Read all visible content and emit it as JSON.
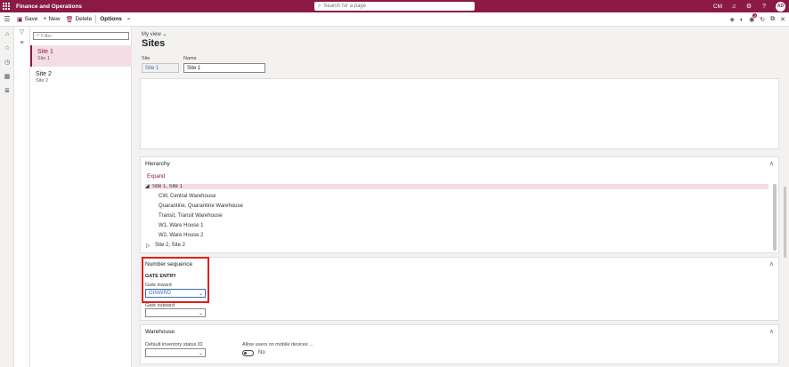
{
  "topbar": {
    "app_title": "Finance and Operations",
    "search_placeholder": "Search for a page",
    "company": "CM",
    "avatar_initials": "AD"
  },
  "actionbar": {
    "save": "Save",
    "new": "New",
    "delete": "Delete",
    "options": "Options",
    "notification_count": "2"
  },
  "list": {
    "filter_placeholder": "Filter",
    "items": [
      {
        "title": "Site 1",
        "subtitle": "Site 1"
      },
      {
        "title": "Site 2",
        "subtitle": "Site 2"
      }
    ]
  },
  "header": {
    "my_view": "My view",
    "page_title": "Sites",
    "site_label": "Site",
    "site_value": "Site 1",
    "name_label": "Name",
    "name_value": "Site 1"
  },
  "hierarchy": {
    "title": "Hierarchy",
    "expand": "Expand",
    "nodes": [
      {
        "label": "Site 1, Site 1",
        "expander": "◢"
      },
      {
        "label": "CW, Central Warehouse"
      },
      {
        "label": "Quarantine, Quarantine Warehouse"
      },
      {
        "label": "Transit, Transit Warehouse"
      },
      {
        "label": "W1, Ware House 1"
      },
      {
        "label": "W2, Ware House 2"
      },
      {
        "label": "Site 2, Site 2",
        "expander": "▷"
      }
    ]
  },
  "number_sequence": {
    "title": "Number sequence",
    "group_caption": "GATE ENTRY",
    "gate_inward_label": "Gate inward",
    "gate_inward_value": "GINWRD",
    "gate_outward_label": "Gate outward",
    "gate_outward_value": ""
  },
  "warehouse": {
    "title": "Warehouse",
    "default_status_label": "Default inventory status ID",
    "default_status_value": "",
    "mobile_label": "Allow users on mobile devices ...",
    "mobile_value": "No"
  },
  "colors": {
    "brand": "#8a1a44",
    "highlight_box": "#e02020",
    "selected_row": "#f4dde5"
  }
}
